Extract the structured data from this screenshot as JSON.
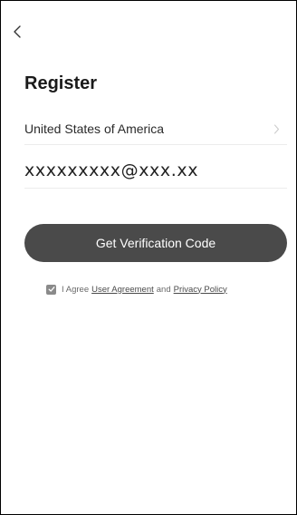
{
  "header": {
    "back_icon": "chevron-left-icon",
    "title": "Register"
  },
  "country": {
    "value": "United States of America",
    "chevron_icon": "chevron-right-icon"
  },
  "email": {
    "value": "xxxxxxxxx@xxx.xx",
    "placeholder": ""
  },
  "actions": {
    "verify_label": "Get Verification Code"
  },
  "agreement": {
    "checked": true,
    "checkbox_icon": "checkmark-icon",
    "prefix": "I Agree",
    "user_agreement_label": "User Agreement",
    "and_text": "and",
    "privacy_policy_label": "Privacy Policy"
  },
  "colors": {
    "button_bg": "#4a4a4a",
    "button_text": "#ffffff",
    "divider": "#ececec",
    "checkbox_bg": "#8a8a8a"
  }
}
